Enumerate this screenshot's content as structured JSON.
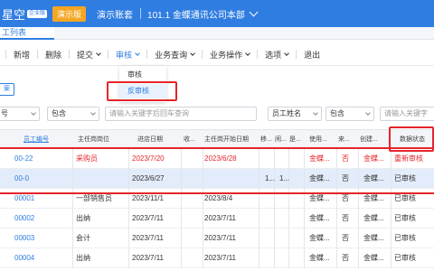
{
  "header": {
    "brand": "星空",
    "brand_tag": "企业版",
    "demo_label": "演示版",
    "account": "演示账套",
    "org": "101.1 金蝶通讯公司本部"
  },
  "tab": {
    "label": "工列表"
  },
  "toolbar": {
    "new": "新增",
    "delete": "删除",
    "submit": "提交",
    "audit": "审核",
    "business_query": "业务查询",
    "business_operation": "业务操作",
    "options": "选项",
    "exit": "退出"
  },
  "audit_menu": {
    "audit": "审核",
    "unaudit": "反审核"
  },
  "small_button": "案",
  "filters": {
    "f1": "号",
    "f2": "包含",
    "f3_placeholder": "请输入关键字后回车查询",
    "f4": "员工姓名",
    "f5": "包含",
    "f6_placeholder": "请输入关键字"
  },
  "columns": {
    "emp_no": "员工编号",
    "position": "主任岗岗位",
    "entry_date": "进店日期",
    "col_short1": "收...",
    "start_date": "主任岗开始日期",
    "col_short2": "移...",
    "col_short3": "闲...",
    "col_short4": "是...",
    "used_by": "使用...",
    "col_short5": "来...",
    "created_by": "创建...",
    "status": "数据状态"
  },
  "rows": [
    {
      "emp_no": "00-22",
      "position": "采购员",
      "entry_date": "2023/7/20",
      "start_date": "2023/6/28",
      "c1": "",
      "c2": "",
      "used_by": "金蝶...",
      "yn": "否",
      "created_by": "金蝶...",
      "status": "重新审核",
      "red": true
    },
    {
      "emp_no": "00-0",
      "position": "",
      "entry_date": "2023/6/27",
      "start_date": "",
      "c1": "1...",
      "c2": "1...",
      "used_by": "金蝶...",
      "yn": "否",
      "created_by": "金蝶...",
      "status": "已审核",
      "red": false
    },
    {
      "emp_no": "00001",
      "position": "一部销售员",
      "entry_date": "2023/11/1",
      "start_date": "2023/8/4",
      "c1": "",
      "c2": "",
      "used_by": "金蝶...",
      "yn": "否",
      "created_by": "金蝶...",
      "status": "已审核",
      "red": false
    },
    {
      "emp_no": "00002",
      "position": "出纳",
      "entry_date": "2023/7/11",
      "start_date": "2023/7/11",
      "c1": "",
      "c2": "",
      "used_by": "金蝶...",
      "yn": "否",
      "created_by": "金蝶...",
      "status": "已审核",
      "red": false
    },
    {
      "emp_no": "00003",
      "position": "会计",
      "entry_date": "2023/7/11",
      "start_date": "2023/7/11",
      "c1": "",
      "c2": "",
      "used_by": "金蝶...",
      "yn": "否",
      "created_by": "金蝶...",
      "status": "已审核",
      "red": false
    },
    {
      "emp_no": "00004",
      "position": "出纳",
      "entry_date": "2023/7/11",
      "start_date": "2023/7/11",
      "c1": "",
      "c2": "",
      "used_by": "金蝶...",
      "yn": "否",
      "created_by": "金蝶...",
      "status": "已审核",
      "red": false
    }
  ],
  "colors": {
    "primary": "#2f7de1",
    "highlight_red": "#e6252b",
    "demo_orange": "#f5a623"
  }
}
